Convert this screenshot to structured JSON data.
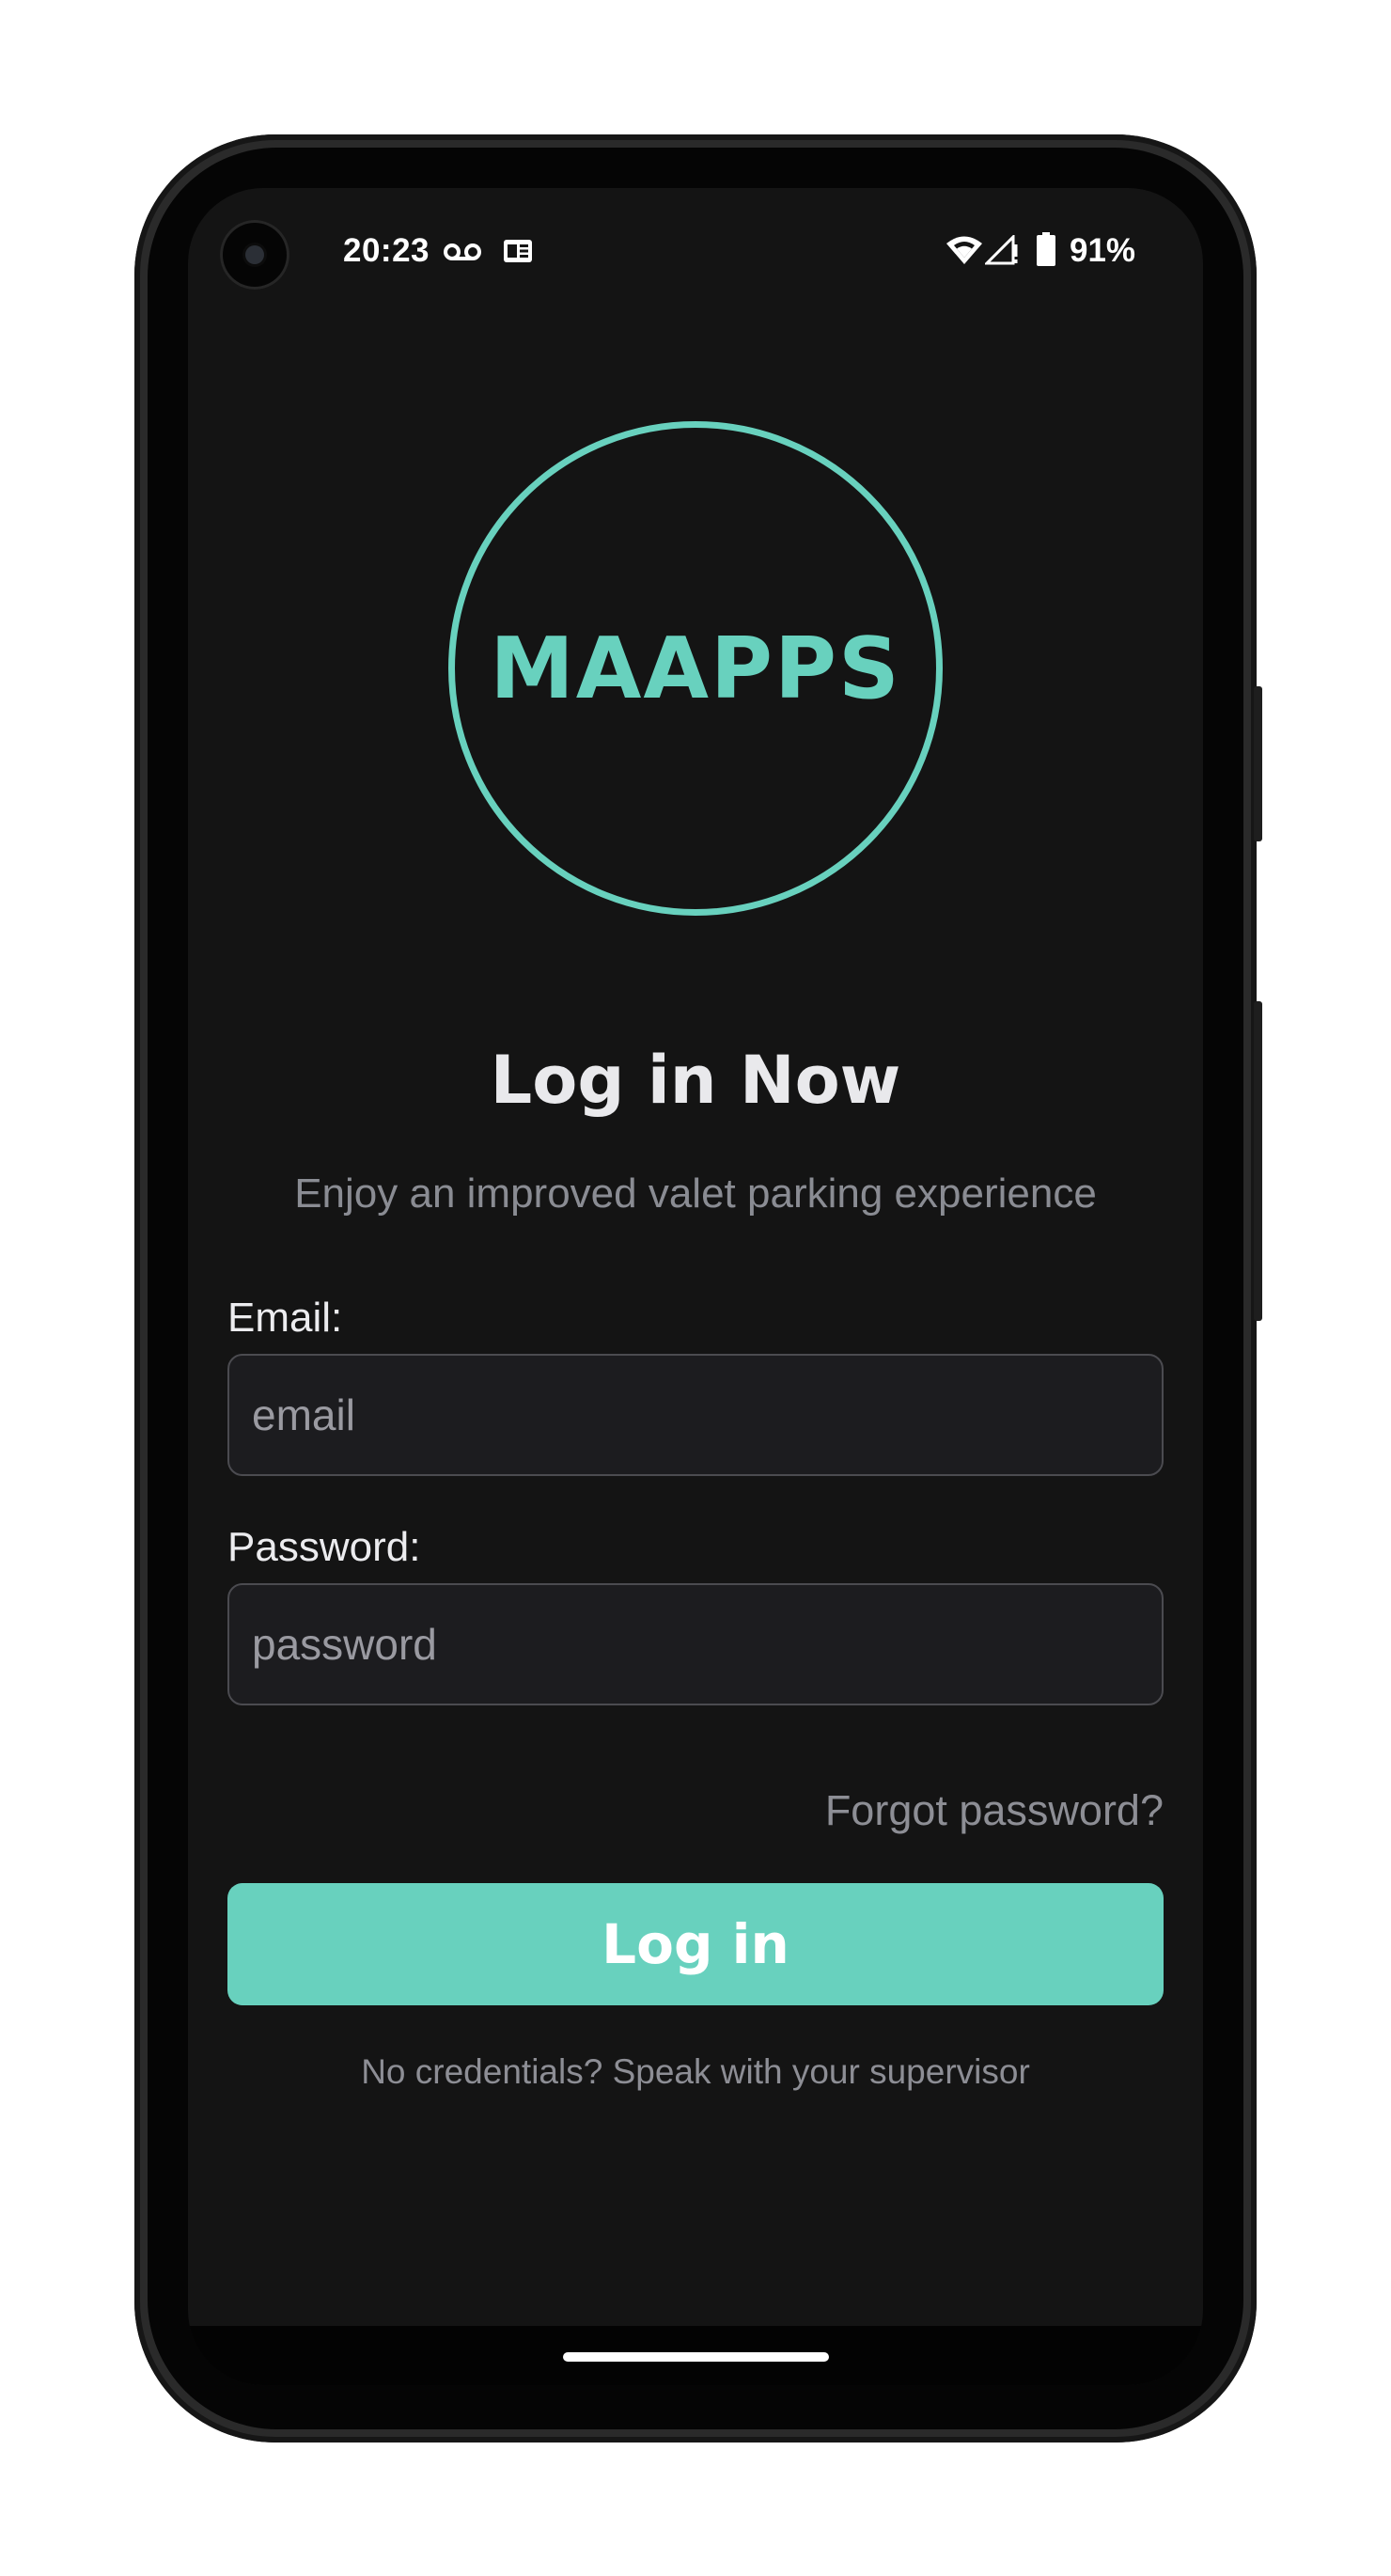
{
  "status_bar": {
    "time": "20:23",
    "battery": "91%",
    "icons": [
      "voicemail-icon",
      "news-card-icon",
      "wifi-icon",
      "cell-signal-icon",
      "battery-icon"
    ]
  },
  "logo": {
    "text": "MAAPPS",
    "accent_color": "#68d1be"
  },
  "header": {
    "title": "Log in Now",
    "subtitle": "Enjoy an improved valet parking experience"
  },
  "form": {
    "email_label": "Email:",
    "email_placeholder": "email",
    "email_value": "",
    "password_label": "Password:",
    "password_placeholder": "password",
    "password_value": "",
    "forgot_link": "Forgot password?",
    "submit_label": "Log in",
    "footnote": "No credentials? Speak with your supervisor"
  },
  "colors": {
    "background": "#141414",
    "accent": "#68d1be",
    "muted_text": "#8d8e95",
    "field_border": "#4b4b50"
  }
}
